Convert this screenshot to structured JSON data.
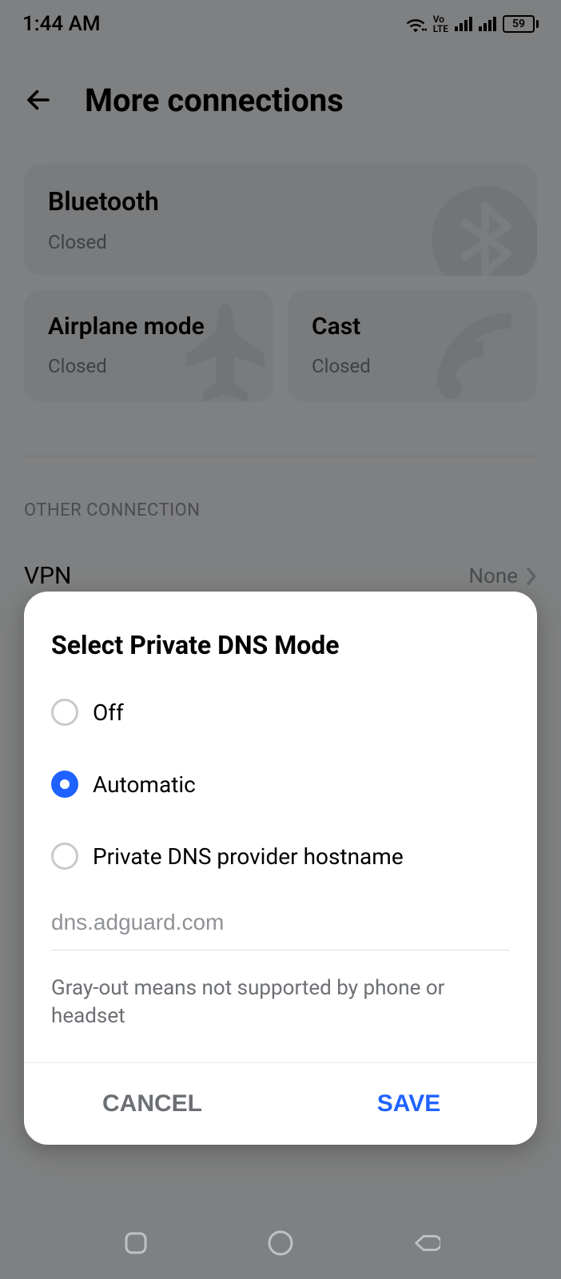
{
  "status": {
    "time": "1:44 AM",
    "volte_top": "Vo",
    "volte_bot": "LTE",
    "battery": "59"
  },
  "header": {
    "title": "More connections"
  },
  "tiles": {
    "bluetooth": {
      "title": "Bluetooth",
      "sub": "Closed"
    },
    "airplane": {
      "title": "Airplane mode",
      "sub": "Closed"
    },
    "cast": {
      "title": "Cast",
      "sub": "Closed"
    }
  },
  "section": {
    "heading": "OTHER CONNECTION",
    "vpn_label": "VPN",
    "vpn_value": "None"
  },
  "dialog": {
    "title": "Select Private DNS Mode",
    "options": {
      "off": "Off",
      "auto": "Automatic",
      "hostname": "Private DNS provider hostname"
    },
    "input_value": "dns.adguard.com",
    "hint": "Gray-out means not supported by phone or headset",
    "cancel": "CANCEL",
    "save": "SAVE"
  }
}
